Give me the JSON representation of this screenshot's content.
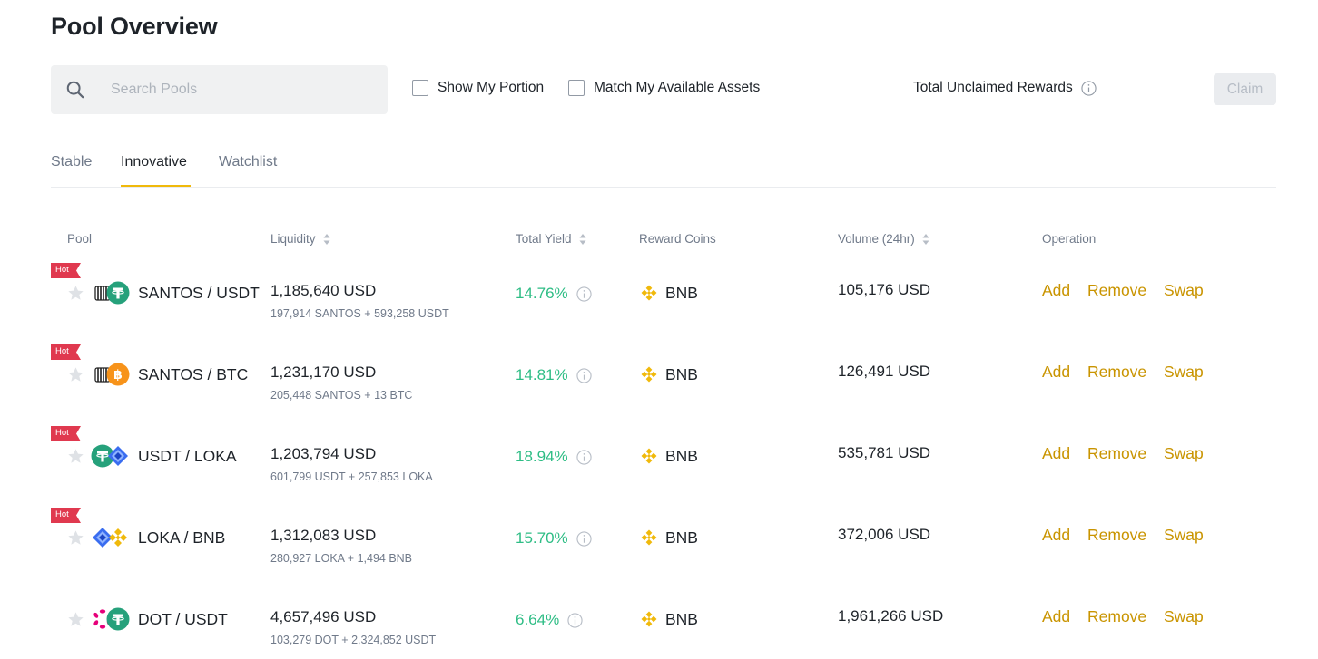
{
  "header": {
    "title": "Pool Overview"
  },
  "search": {
    "placeholder": "Search Pools",
    "value": ""
  },
  "filters": {
    "show_my_portion": {
      "label": "Show My Portion",
      "checked": false
    },
    "match_assets": {
      "label": "Match My Available Assets",
      "checked": false
    }
  },
  "rewards": {
    "label": "Total Unclaimed Rewards",
    "claim_label": "Claim"
  },
  "tabs": [
    {
      "label": "Stable",
      "active": false
    },
    {
      "label": "Innovative",
      "active": true
    },
    {
      "label": "Watchlist",
      "active": false
    }
  ],
  "table": {
    "columns": {
      "pool": "Pool",
      "liquidity": "Liquidity",
      "total_yield": "Total Yield",
      "reward_coins": "Reward Coins",
      "volume": "Volume (24hr)",
      "operation": "Operation"
    },
    "operations": {
      "add": "Add",
      "remove": "Remove",
      "swap": "Swap"
    },
    "rows": [
      {
        "hot": "Hot",
        "pair": "SANTOS / USDT",
        "liquidity": "1,185,640 USD",
        "composition": "197,914 SANTOS + 593,258 USDT",
        "yield": "14.76%",
        "reward": "BNB",
        "volume": "105,176 USD"
      },
      {
        "hot": "Hot",
        "pair": "SANTOS / BTC",
        "liquidity": "1,231,170 USD",
        "composition": "205,448 SANTOS + 13 BTC",
        "yield": "14.81%",
        "reward": "BNB",
        "volume": "126,491 USD"
      },
      {
        "hot": "Hot",
        "pair": "USDT / LOKA",
        "liquidity": "1,203,794 USD",
        "composition": "601,799 USDT + 257,853 LOKA",
        "yield": "18.94%",
        "reward": "BNB",
        "volume": "535,781 USD"
      },
      {
        "hot": "Hot",
        "pair": "LOKA / BNB",
        "liquidity": "1,312,083 USD",
        "composition": "280,927 LOKA + 1,494 BNB",
        "yield": "15.70%",
        "reward": "BNB",
        "volume": "372,006 USD"
      },
      {
        "hot": "",
        "pair": "DOT / USDT",
        "liquidity": "4,657,496 USD",
        "composition": "103,279 DOT + 2,324,852 USDT",
        "yield": "6.64%",
        "reward": "BNB",
        "volume": "1,961,266 USD"
      }
    ]
  },
  "colors": {
    "accent": "#f0b90b",
    "link": "#c99400",
    "positive": "#2ebd85",
    "hot": "#e0394f",
    "muted": "#707a8a"
  }
}
